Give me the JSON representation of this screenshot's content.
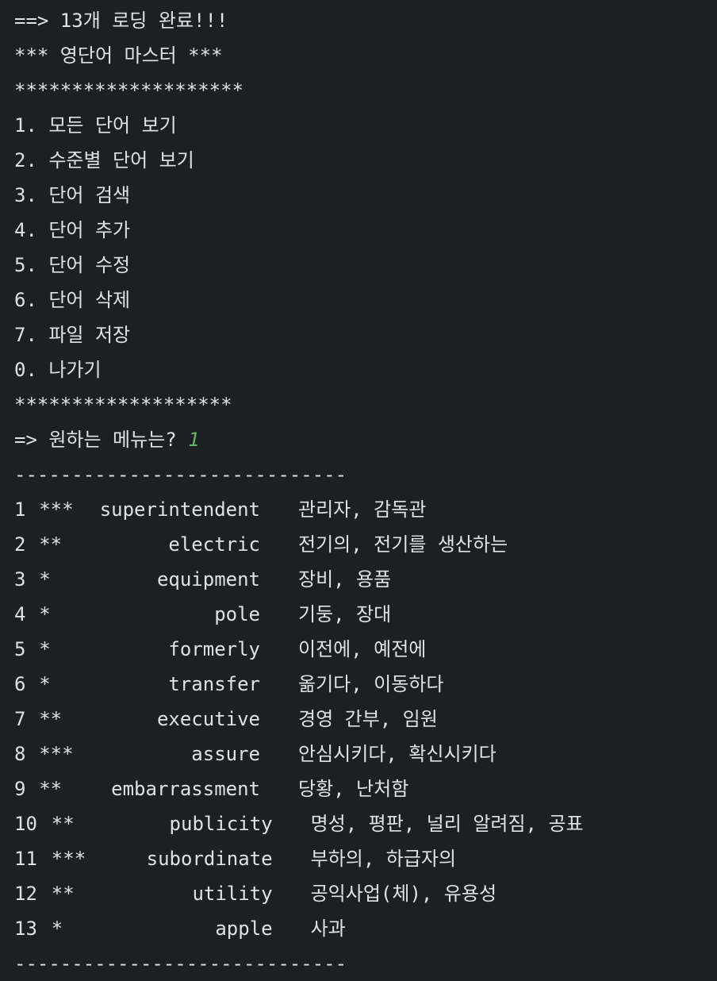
{
  "console": {
    "load_message": "==> 13개 로딩 완료!!!",
    "title": "*** 영단어 마스터 ***",
    "top_border": "********************",
    "menu_items": [
      "1. 모든 단어 보기",
      "2. 수준별 단어 보기",
      "3. 단어 검색",
      "4. 단어 추가",
      "5. 단어 수정",
      "6. 단어 삭제",
      "7. 파일 저장",
      "0. 나가기"
    ],
    "bottom_border": "*******************",
    "prompt": "=> 원하는 메뉴는? ",
    "input_value": "1",
    "divider": "-----------------------------",
    "words": [
      {
        "no": "1",
        "level": "***",
        "word": "superintendent",
        "meaning": "관리자, 감독관"
      },
      {
        "no": "2",
        "level": "**",
        "word": "electric",
        "meaning": "전기의, 전기를 생산하는"
      },
      {
        "no": "3",
        "level": "*",
        "word": "equipment",
        "meaning": "장비, 용품"
      },
      {
        "no": "4",
        "level": "*",
        "word": "pole",
        "meaning": "기둥, 장대"
      },
      {
        "no": "5",
        "level": "*",
        "word": "formerly",
        "meaning": "이전에, 예전에"
      },
      {
        "no": "6",
        "level": "*",
        "word": "transfer",
        "meaning": "옮기다, 이동하다"
      },
      {
        "no": "7",
        "level": "**",
        "word": "executive",
        "meaning": "경영 간부, 임원"
      },
      {
        "no": "8",
        "level": "***",
        "word": "assure",
        "meaning": "안심시키다, 확신시키다"
      },
      {
        "no": "9",
        "level": "**",
        "word": "embarrassment",
        "meaning": "당황, 난처함"
      },
      {
        "no": "10",
        "level": "**",
        "word": "publicity",
        "meaning": "명성, 평판, 널리 알려짐, 공표"
      },
      {
        "no": "11",
        "level": "***",
        "word": "subordinate",
        "meaning": "부하의, 하급자의"
      },
      {
        "no": "12",
        "level": "**",
        "word": "utility",
        "meaning": "공익사업(체), 유용성"
      },
      {
        "no": "13",
        "level": "*",
        "word": "apple",
        "meaning": "사과"
      }
    ],
    "end_divider": "-----------------------------"
  },
  "colors": {
    "background": "#1e1f22",
    "text": "#dfe1e5",
    "user_input": "#5fb865"
  }
}
